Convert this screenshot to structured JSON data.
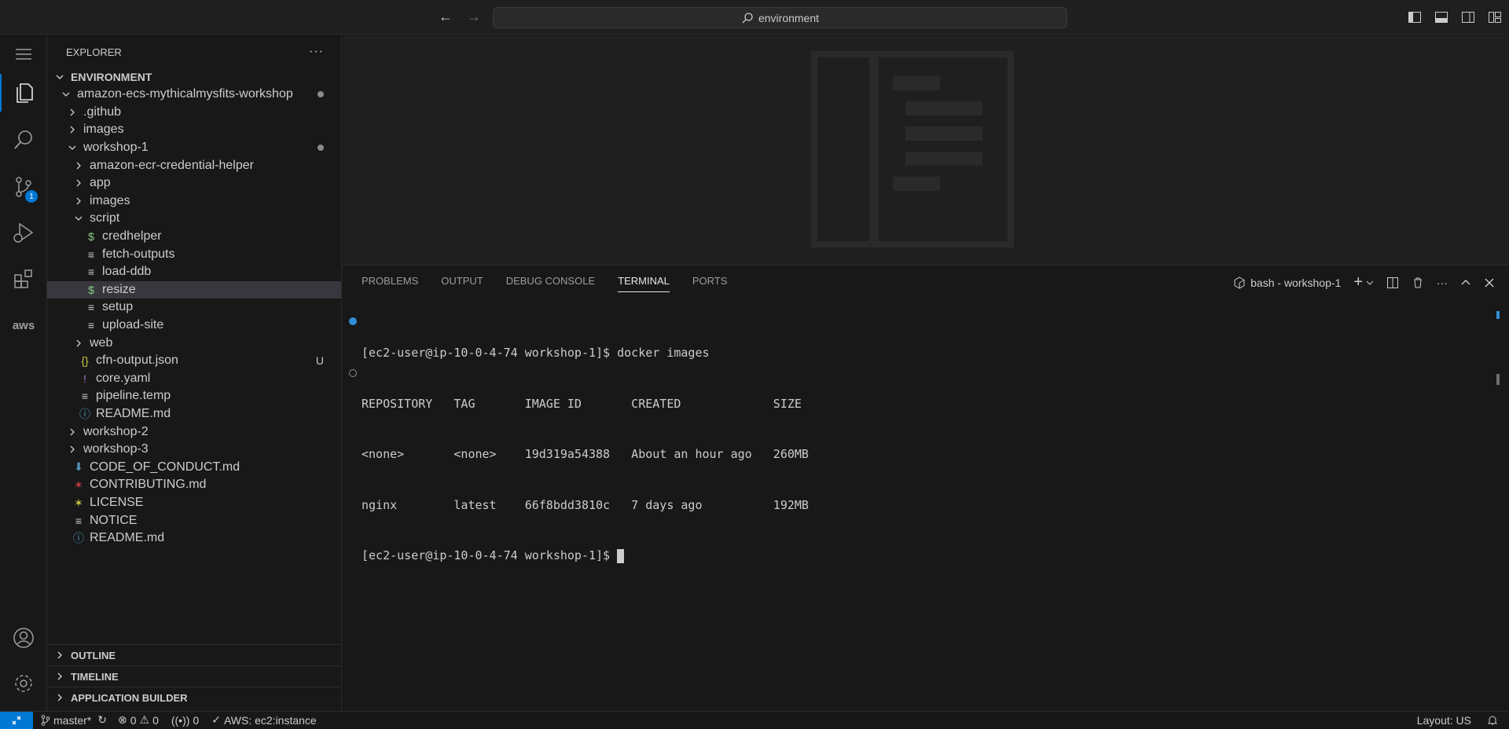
{
  "titlebar": {
    "search_text": "environment"
  },
  "activity": {
    "scm_badge": "1",
    "aws_label": "aws"
  },
  "explorer": {
    "title": "EXPLORER",
    "more": "···",
    "section": "ENVIRONMENT",
    "items": [
      {
        "label": "amazon-ecs-mythicalmysfits-workshop",
        "type": "folder-open",
        "depth": 1,
        "decoration": "dot"
      },
      {
        "label": ".github",
        "type": "folder",
        "depth": 2
      },
      {
        "label": "images",
        "type": "folder",
        "depth": 2
      },
      {
        "label": "workshop-1",
        "type": "folder-open",
        "depth": 2,
        "decoration": "dot"
      },
      {
        "label": "amazon-ecr-credential-helper",
        "type": "folder",
        "depth": 3
      },
      {
        "label": "app",
        "type": "folder",
        "depth": 3
      },
      {
        "label": "images",
        "type": "folder",
        "depth": 3
      },
      {
        "label": "script",
        "type": "folder-open",
        "depth": 3
      },
      {
        "label": "credhelper",
        "type": "shell",
        "depth": 4
      },
      {
        "label": "fetch-outputs",
        "type": "text",
        "depth": 4
      },
      {
        "label": "load-ddb",
        "type": "text",
        "depth": 4
      },
      {
        "label": "resize",
        "type": "shell",
        "depth": 4,
        "selected": true
      },
      {
        "label": "setup",
        "type": "text",
        "depth": 4
      },
      {
        "label": "upload-site",
        "type": "text",
        "depth": 4
      },
      {
        "label": "web",
        "type": "folder",
        "depth": 3
      },
      {
        "label": "cfn-output.json",
        "type": "json",
        "depth": 3,
        "decoration": "U"
      },
      {
        "label": "core.yaml",
        "type": "yaml",
        "depth": 3
      },
      {
        "label": "pipeline.temp",
        "type": "text",
        "depth": 3
      },
      {
        "label": "README.md",
        "type": "info",
        "depth": 3
      },
      {
        "label": "workshop-2",
        "type": "folder",
        "depth": 2
      },
      {
        "label": "workshop-3",
        "type": "folder",
        "depth": 2
      },
      {
        "label": "CODE_OF_CONDUCT.md",
        "type": "download",
        "depth": 2
      },
      {
        "label": "CONTRIBUTING.md",
        "type": "ribbon-red",
        "depth": 2
      },
      {
        "label": "LICENSE",
        "type": "ribbon-yellow",
        "depth": 2
      },
      {
        "label": "NOTICE",
        "type": "text",
        "depth": 2
      },
      {
        "label": "README.md",
        "type": "info",
        "depth": 2
      }
    ],
    "bottom_sections": [
      "OUTLINE",
      "TIMELINE",
      "APPLICATION BUILDER"
    ]
  },
  "panel": {
    "tabs": [
      "PROBLEMS",
      "OUTPUT",
      "DEBUG CONSOLE",
      "TERMINAL",
      "PORTS"
    ],
    "active_tab": "TERMINAL",
    "terminal_name": "bash - workshop-1",
    "lines": [
      "[ec2-user@ip-10-0-4-74 workshop-1]$ docker images",
      "REPOSITORY   TAG       IMAGE ID       CREATED             SIZE",
      "<none>       <none>    19d319a54388   About an hour ago   260MB",
      "nginx        latest    66f8bdd3810c   7 days ago          192MB",
      "[ec2-user@ip-10-0-4-74 workshop-1]$ "
    ]
  },
  "status": {
    "branch": "master*",
    "errors": "0",
    "warnings": "0",
    "ports": "0",
    "aws": "AWS: ec2:instance",
    "layout": "Layout: US"
  }
}
